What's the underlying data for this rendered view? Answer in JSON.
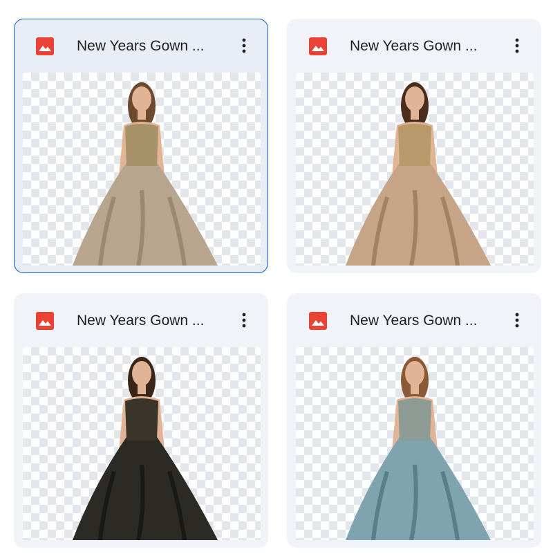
{
  "files": [
    {
      "name": "New Years Gown ...",
      "selected": true,
      "icon": "image-file-icon",
      "menu_icon": "more-vert-icon",
      "gown_color": "#b7a58e",
      "gown_shade": "#8e7c66",
      "bodice_color": "#a8926a",
      "hair_color": "#6b4a30"
    },
    {
      "name": "New Years Gown ...",
      "selected": false,
      "icon": "image-file-icon",
      "menu_icon": "more-vert-icon",
      "gown_color": "#c6a488",
      "gown_shade": "#946f55",
      "bodice_color": "#b89a6a",
      "hair_color": "#4a2e1c"
    },
    {
      "name": "New Years Gown ...",
      "selected": false,
      "icon": "image-file-icon",
      "menu_icon": "more-vert-icon",
      "gown_color": "#2b2a24",
      "gown_shade": "#121210",
      "bodice_color": "#3a342a",
      "hair_color": "#3a2618"
    },
    {
      "name": "New Years Gown ...",
      "selected": false,
      "icon": "image-file-icon",
      "menu_icon": "more-vert-icon",
      "gown_color": "#7fa4b0",
      "gown_shade": "#4a6f7c",
      "bodice_color": "#8e9a94",
      "hair_color": "#8a5a36"
    }
  ],
  "colors": {
    "card_bg": "#f0f4f9",
    "selected_border": "#0b57d0",
    "image_icon_red": "#ea4335",
    "title_text": "#1f1f1f"
  }
}
